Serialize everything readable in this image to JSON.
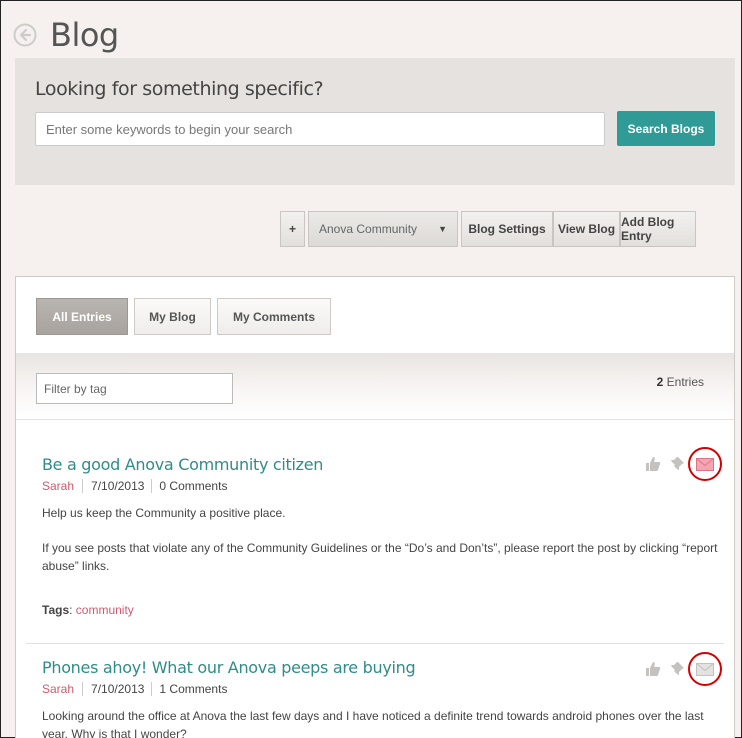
{
  "header": {
    "title": "Blog"
  },
  "search": {
    "heading": "Looking for something specific?",
    "placeholder": "Enter some keywords to begin your search",
    "button_label": "Search Blogs"
  },
  "toolbar": {
    "plus_label": "+",
    "community_select": "Anova Community",
    "settings_label": "Blog Settings",
    "view_label": "View Blog",
    "add_label": "Add Blog Entry"
  },
  "tabs": [
    {
      "label": "All Entries",
      "active": true
    },
    {
      "label": "My Blog",
      "active": false
    },
    {
      "label": "My Comments",
      "active": false
    }
  ],
  "filter": {
    "placeholder": "Filter by tag",
    "count": "2",
    "count_label": "Entries"
  },
  "entries": [
    {
      "title": "Be a good Anova Community citizen",
      "author": "Sarah",
      "date": "7/10/2013",
      "comments": "0 Comments",
      "body": [
        "Help us keep the Community a positive place.",
        "If you see posts that violate any of the Community Guidelines or the “Do’s and Don’ts”, please report the post by clicking “report abuse” links."
      ],
      "tags_label": "Tags",
      "tags": [
        "community"
      ]
    },
    {
      "title": "Phones ahoy! What our Anova peeps are buying",
      "author": "Sarah",
      "date": "7/10/2013",
      "comments": "1 Comments",
      "body": [
        "Looking around the office at Anova the last few days and I have noticed a definite trend towards android phones over the last year. Why is that I wonder?"
      ]
    }
  ],
  "colors": {
    "accent": "#2f9a96",
    "title_link": "#2f8c88",
    "author": "#d05a6e",
    "highlight_circle": "#d40000"
  },
  "icons": [
    "back-arrow-icon",
    "thumbs-up-icon",
    "pin-icon",
    "mail-icon"
  ]
}
